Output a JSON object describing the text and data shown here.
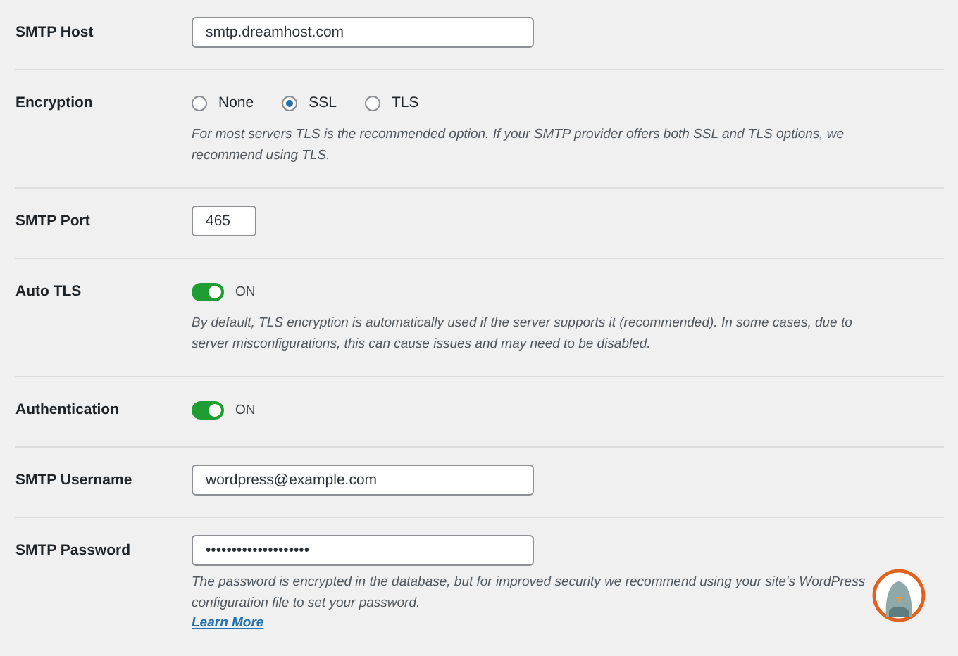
{
  "fields": [
    {
      "kind": "text",
      "label": "SMTP Host",
      "value": "smtp.dreamhost.com"
    },
    {
      "kind": "radio",
      "label": "Encryption",
      "options": [
        {
          "label": "None",
          "selected": false
        },
        {
          "label": "SSL",
          "selected": true
        },
        {
          "label": "TLS",
          "selected": false
        }
      ],
      "description": "For most servers TLS is the recommended option. If your SMTP provider offers both SSL and TLS options, we recommend using TLS."
    },
    {
      "kind": "number",
      "label": "SMTP Port",
      "value": "465"
    },
    {
      "kind": "toggle",
      "label": "Auto TLS",
      "on": true,
      "state_text": "ON",
      "description": "By default, TLS encryption is automatically used if the server supports it (recommended). In some cases, due to server misconfigurations, this can cause issues and may need to be disabled."
    },
    {
      "kind": "toggle",
      "label": "Authentication",
      "on": true,
      "state_text": "ON"
    },
    {
      "kind": "text",
      "label": "SMTP Username",
      "value": "wordpress@example.com"
    },
    {
      "kind": "password",
      "label": "SMTP Password",
      "value": "••••••••••••••••••••",
      "description": "The password is encrypted in the database, but for improved security we recommend using your site's WordPress configuration file to set your password.",
      "link": "Learn More"
    }
  ]
}
